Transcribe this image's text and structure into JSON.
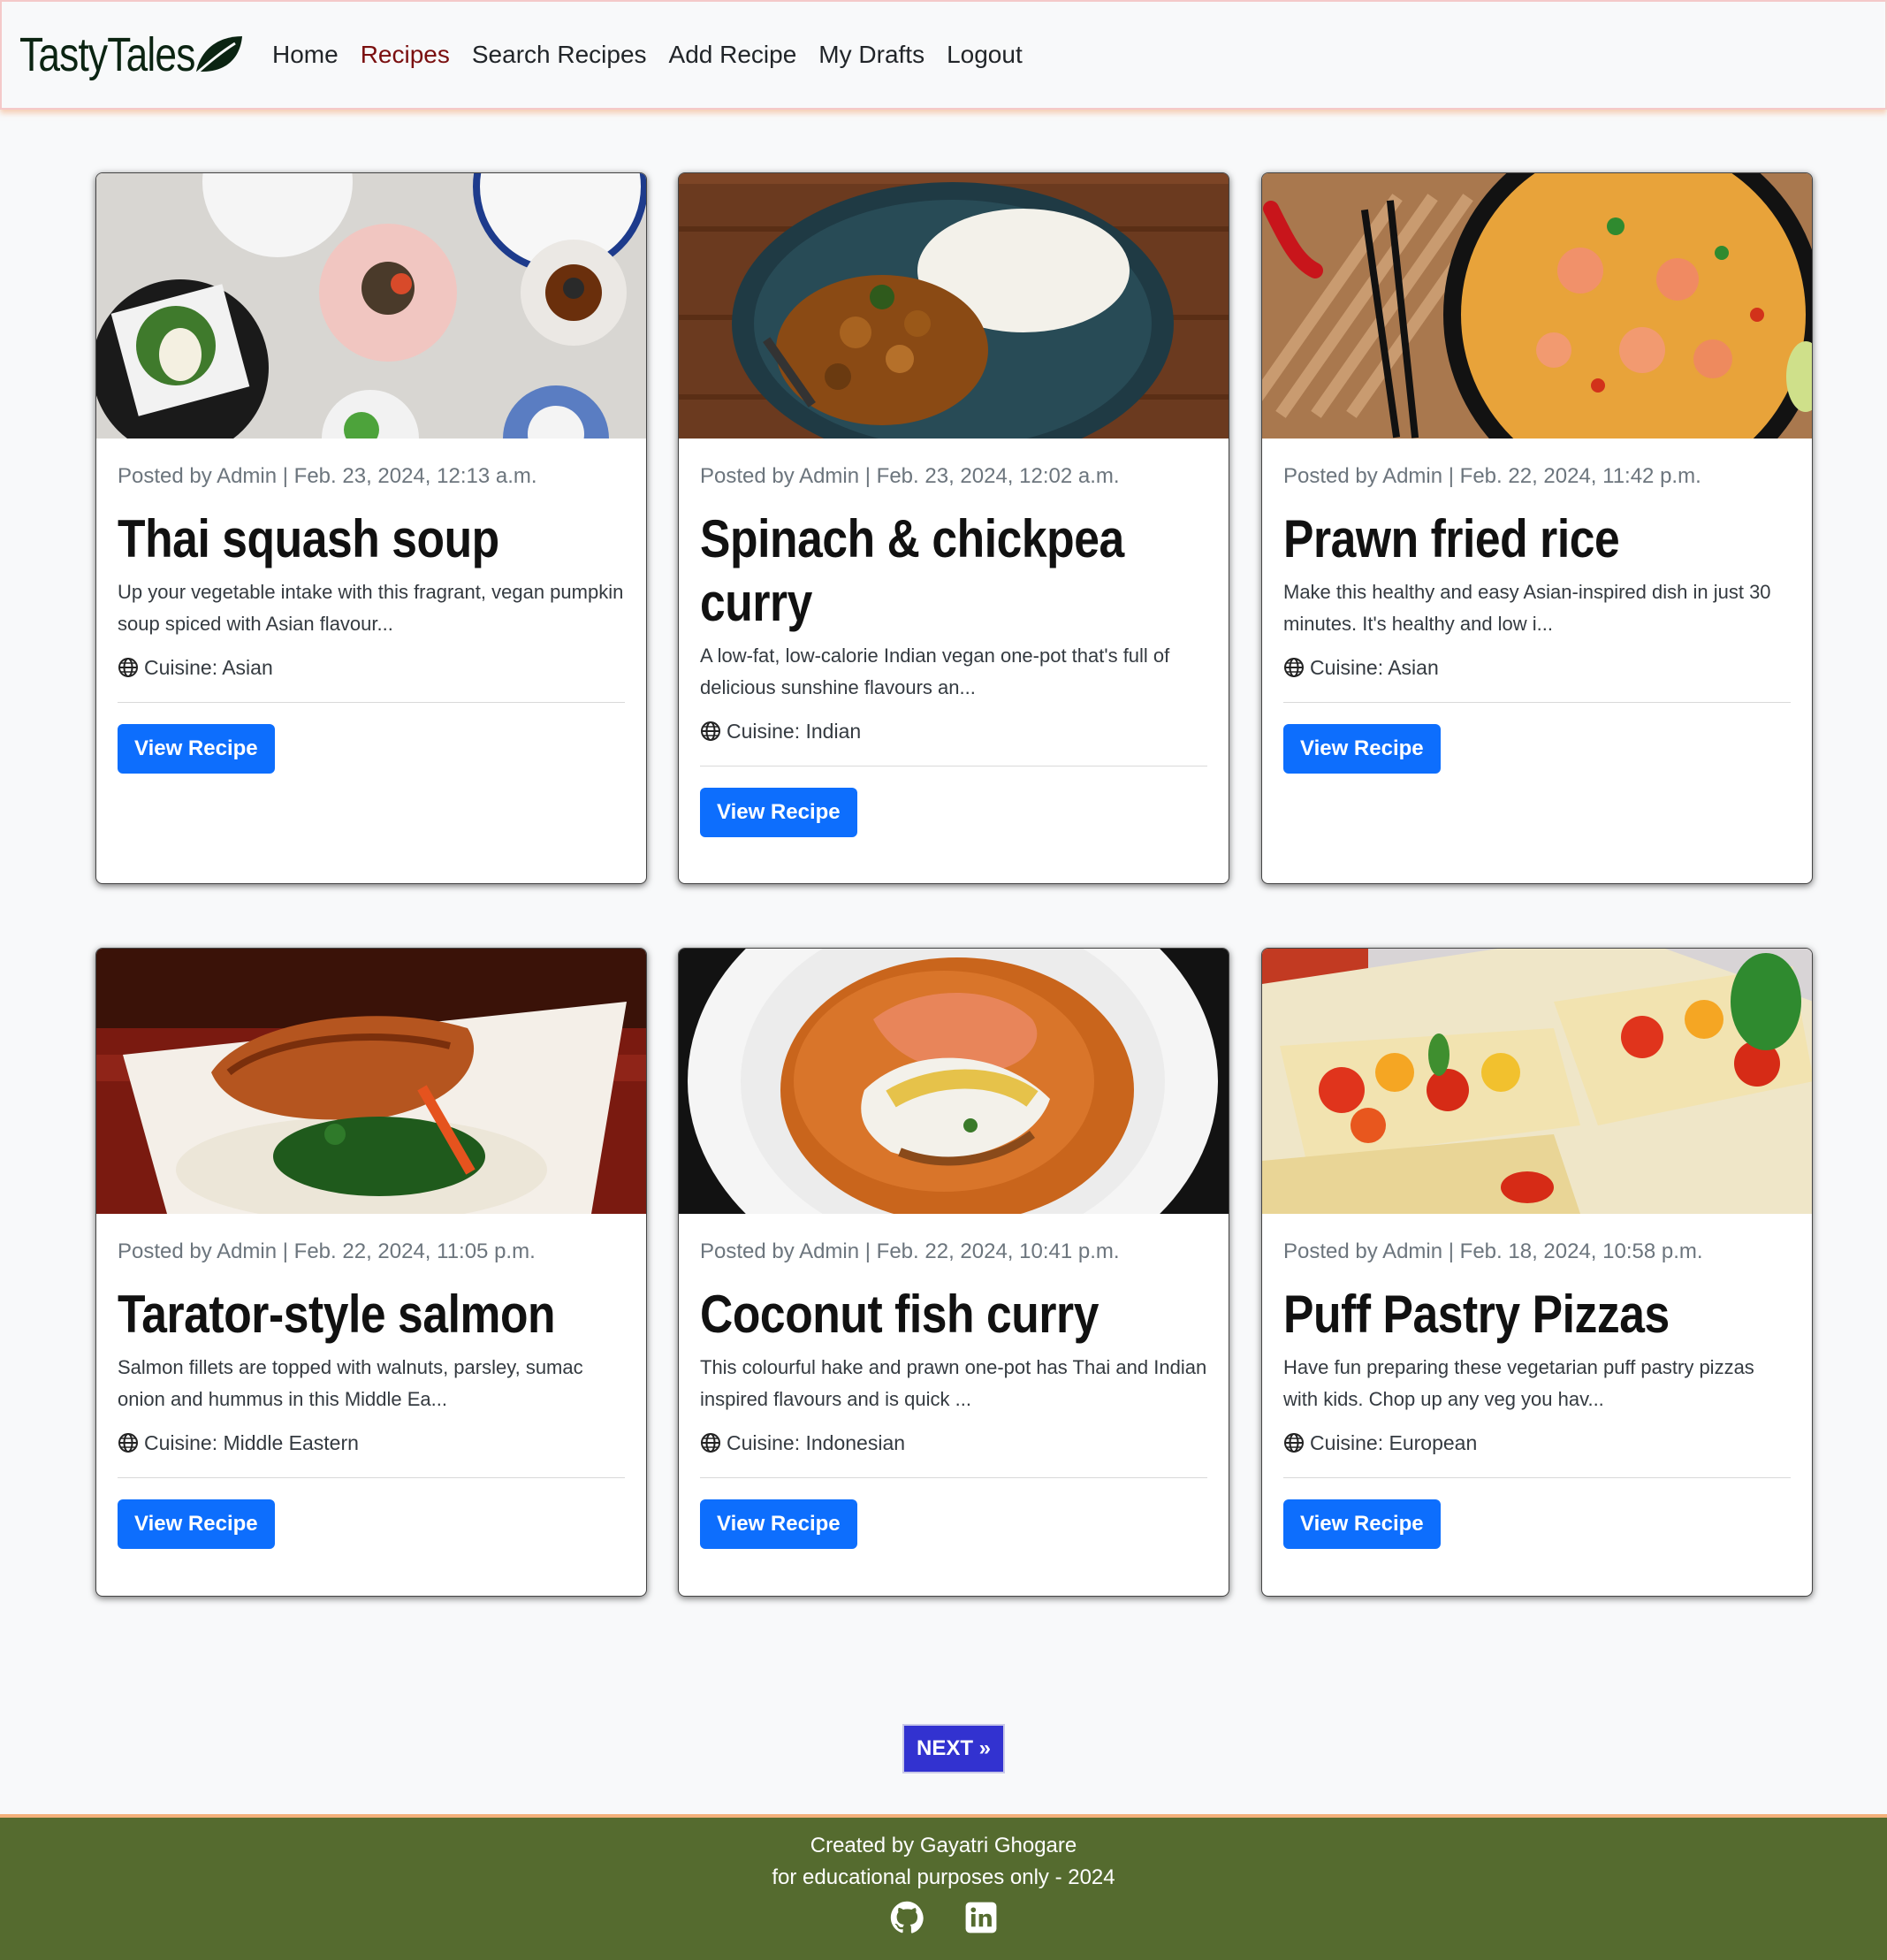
{
  "navbar": {
    "brand": "TastyTales",
    "links": [
      "Home",
      "Recipes",
      "Search Recipes",
      "Add Recipe",
      "My Drafts",
      "Logout"
    ],
    "active": "Recipes"
  },
  "recipes": [
    {
      "meta": "Posted by Admin | Feb. 23, 2024, 12:13 a.m.",
      "title": "Thai squash soup",
      "description": "Up your vegetable intake with this fragrant, vegan pumpkin soup spiced with Asian flavour...",
      "cuisine": "Cuisine: Asian",
      "button": "View Recipe",
      "image": "plates-of-appetizers-on-marble"
    },
    {
      "meta": "Posted by Admin | Feb. 23, 2024, 12:02 a.m.",
      "title": "Spinach & chickpea curry",
      "description": "A low-fat, low-calorie Indian vegan one-pot that's full of delicious sunshine flavours an...",
      "cuisine": "Cuisine: Indian",
      "button": "View Recipe",
      "image": "chickpea-curry-with-rice"
    },
    {
      "meta": "Posted by Admin | Feb. 22, 2024, 11:42 p.m.",
      "title": "Prawn fried rice",
      "description": "Make this healthy and easy Asian-inspired dish in just 30 minutes. It's healthy and low i...",
      "cuisine": "Cuisine: Asian",
      "button": "View Recipe",
      "image": "prawn-fried-rice-bowl"
    },
    {
      "meta": "Posted by Admin | Feb. 22, 2024, 11:05 p.m.",
      "title": "Tarator-style salmon",
      "description": "Salmon fillets are topped with walnuts, parsley, sumac onion and hummus in this Middle Ea...",
      "cuisine": "Cuisine: Middle Eastern",
      "button": "View Recipe",
      "image": "salmon-fillet-on-mash"
    },
    {
      "meta": "Posted by Admin | Feb. 22, 2024, 10:41 p.m.",
      "title": "Coconut fish curry",
      "description": "This colourful hake and prawn one-pot has Thai and Indian inspired flavours and is quick ...",
      "cuisine": "Cuisine: Indonesian",
      "button": "View Recipe",
      "image": "fish-curry-in-white-bowl"
    },
    {
      "meta": "Posted by Admin | Feb. 18, 2024, 10:58 p.m.",
      "title": "Puff Pastry Pizzas",
      "description": "Have fun preparing these vegetarian puff pastry pizzas with kids. Chop up any veg you hav...",
      "cuisine": "Cuisine: European",
      "button": "View Recipe",
      "image": "puff-pastry-tomato-tarts"
    }
  ],
  "pagination": {
    "next": "NEXT »"
  },
  "footer": {
    "line1": "Created by Gayatri Ghogare",
    "line2": "for educational purposes only - 2024",
    "icons": [
      "github-icon",
      "linkedin-icon"
    ]
  },
  "colors": {
    "primary_button": "#0d6efd",
    "active_nav": "#7a0f0f",
    "next_button": "#3232d0",
    "footer_bg": "#556b2f"
  }
}
